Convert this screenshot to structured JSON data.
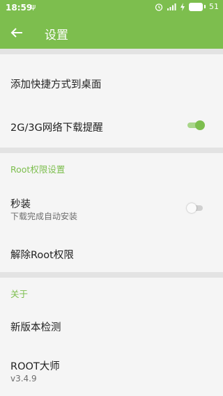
{
  "status_bar": {
    "time": "18:59",
    "usb_icon": "usb-icon",
    "battery_level": "51"
  },
  "app_bar": {
    "title": "设置",
    "back_icon": "arrow-left-icon"
  },
  "items": {
    "add_shortcut": {
      "title": "添加快捷方式到桌面"
    },
    "network_reminder": {
      "title": "2G/3G网络下载提醒",
      "switch_on": true
    },
    "root_section": {
      "header": "Root权限设置"
    },
    "quick_install": {
      "title": "秒装",
      "subtitle": "下载完成自动安装",
      "switch_on": false
    },
    "remove_root": {
      "title": "解除Root权限"
    },
    "about_section": {
      "header": "关于"
    },
    "check_update": {
      "title": "新版本检测"
    },
    "app_info": {
      "title": "ROOT大师",
      "version": "v3.4.9"
    }
  },
  "colors": {
    "accent": "#7dbe4e",
    "divider": "#e3e3e3",
    "background": "#f5f5f5"
  }
}
